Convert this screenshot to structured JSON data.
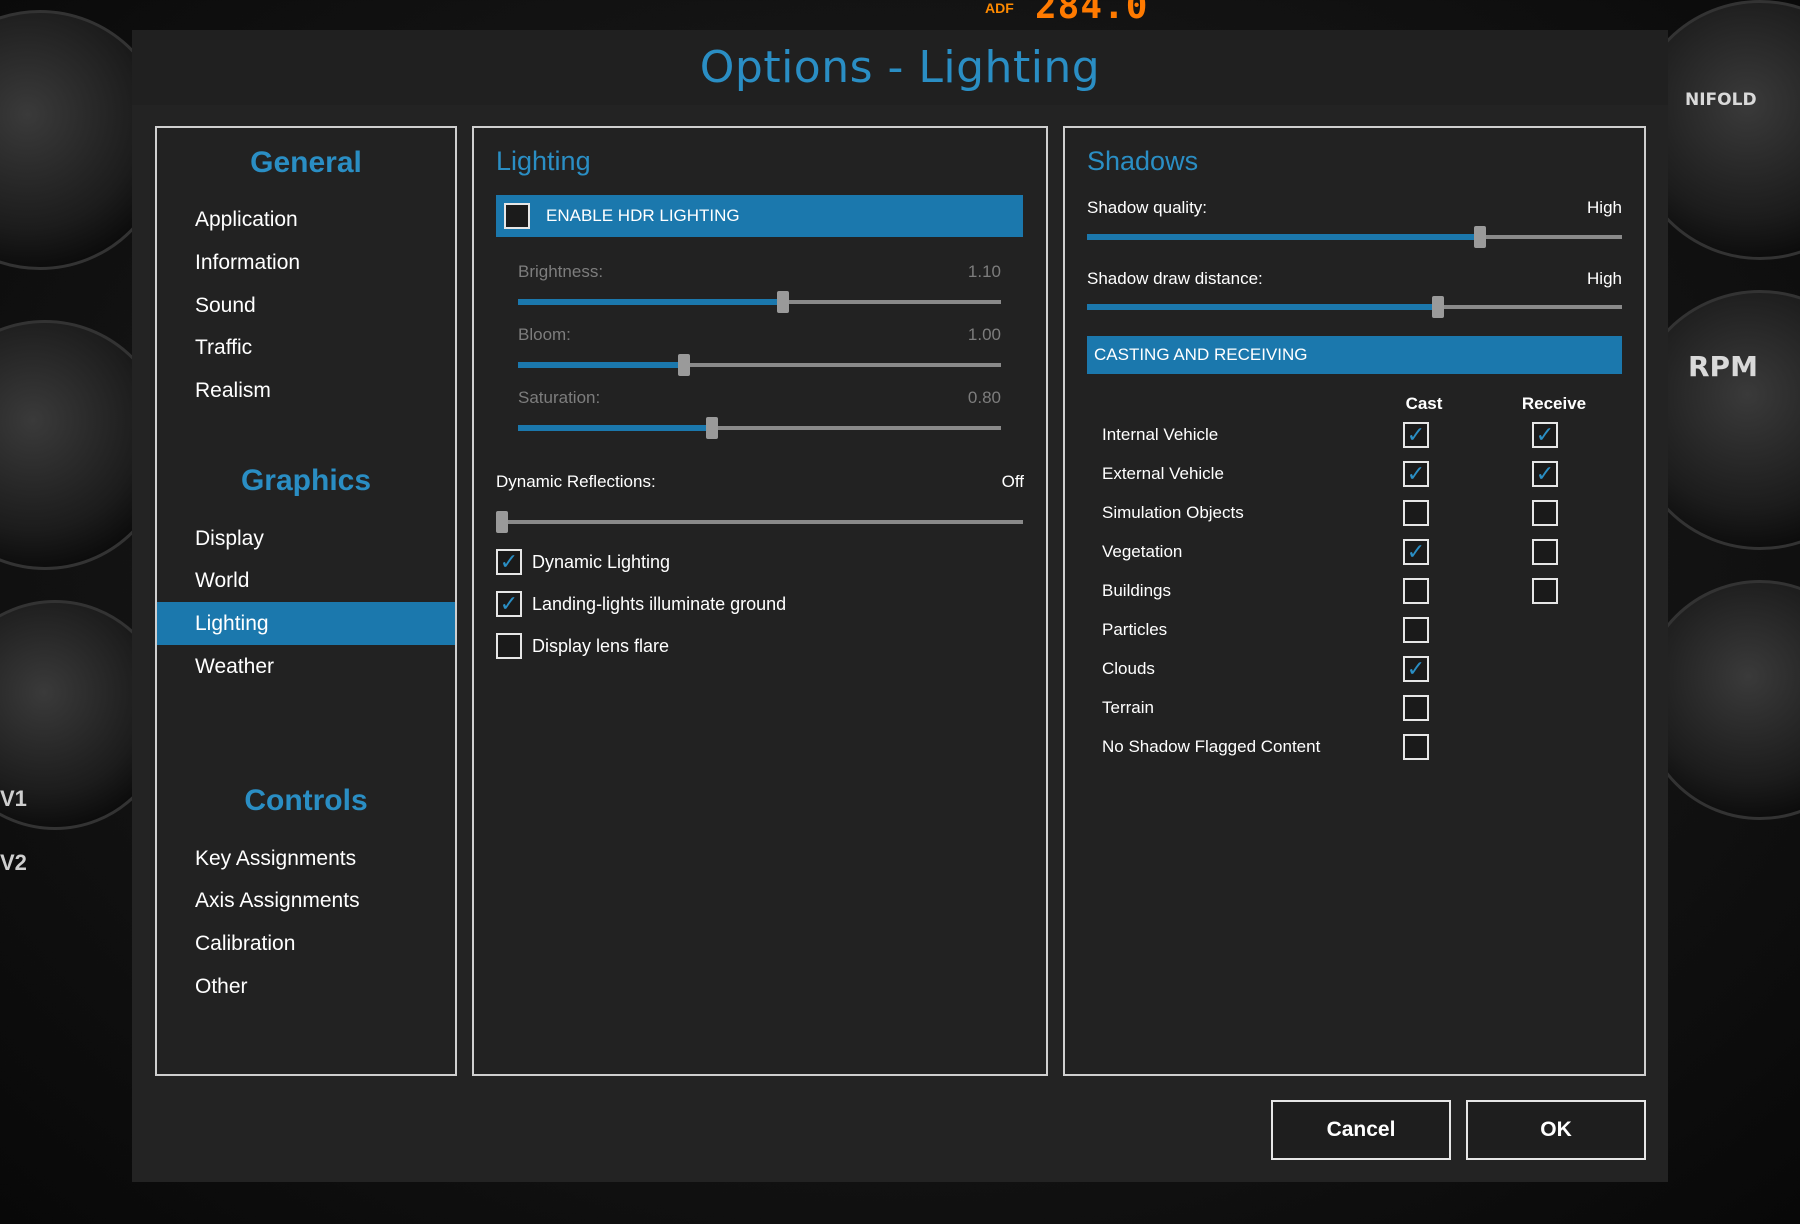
{
  "background": {
    "adf_tag": "ADF",
    "adf_value": "284.0",
    "manifold_label": "NIFOLD",
    "rpm_label": "RPM",
    "v_labels": [
      "V1",
      "V2"
    ]
  },
  "dialog": {
    "title": "Options - Lighting",
    "accent_color": "#2a8ec4",
    "selection_color": "#1b78ad"
  },
  "nav": {
    "general_heading": "General",
    "general_items": [
      "Application",
      "Information",
      "Sound",
      "Traffic",
      "Realism"
    ],
    "graphics_heading": "Graphics",
    "graphics_items": [
      "Display",
      "World",
      "Lighting",
      "Weather"
    ],
    "controls_heading": "Controls",
    "controls_items": [
      "Key Assignments",
      "Axis Assignments",
      "Calibration",
      "Other"
    ],
    "active_item": "Lighting"
  },
  "lighting": {
    "title": "Lighting",
    "hdr_label": "ENABLE HDR LIGHTING",
    "hdr_checked": false,
    "brightness": {
      "label": "Brightness:",
      "value": "1.10",
      "fraction": 0.55
    },
    "bloom": {
      "label": "Bloom:",
      "value": "1.00",
      "fraction": 0.34
    },
    "saturation": {
      "label": "Saturation:",
      "value": "0.80",
      "fraction": 0.4
    },
    "dynamic_reflections": {
      "label": "Dynamic Reflections:",
      "value": "Off",
      "fraction": 0.0
    },
    "checkboxes": [
      {
        "label": "Dynamic Lighting",
        "checked": true
      },
      {
        "label": "Landing-lights illuminate ground",
        "checked": true
      },
      {
        "label": "Display lens flare",
        "checked": false
      }
    ]
  },
  "shadows": {
    "title": "Shadows",
    "quality": {
      "label": "Shadow quality:",
      "value": "High",
      "fraction": 0.74
    },
    "draw_distance": {
      "label": "Shadow draw distance:",
      "value": "High",
      "fraction": 0.66
    },
    "casting_header": "CASTING AND RECEIVING",
    "col_cast": "Cast",
    "col_receive": "Receive",
    "rows": [
      {
        "label": "Internal Vehicle",
        "cast": true,
        "receive": true
      },
      {
        "label": "External Vehicle",
        "cast": true,
        "receive": true
      },
      {
        "label": "Simulation Objects",
        "cast": false,
        "receive": false
      },
      {
        "label": "Vegetation",
        "cast": true,
        "receive": false
      },
      {
        "label": "Buildings",
        "cast": false,
        "receive": false
      },
      {
        "label": "Particles",
        "cast": false,
        "receive": null
      },
      {
        "label": "Clouds",
        "cast": true,
        "receive": null
      },
      {
        "label": "Terrain",
        "cast": false,
        "receive": null
      },
      {
        "label": "No Shadow Flagged Content",
        "cast": false,
        "receive": null
      }
    ]
  },
  "buttons": {
    "cancel": "Cancel",
    "ok": "OK"
  }
}
